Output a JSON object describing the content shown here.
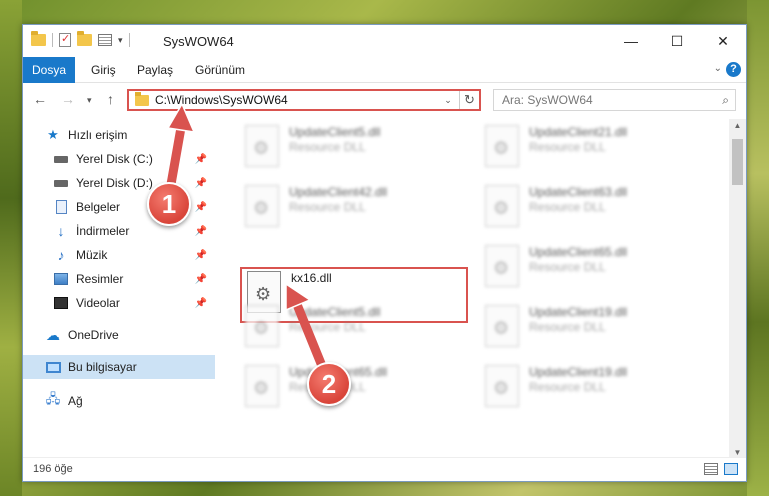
{
  "window": {
    "title": "SysWOW64",
    "minimize": "—",
    "maximize": "☐",
    "close": "✕"
  },
  "ribbon": {
    "tabs": [
      "Dosya",
      "Giriş",
      "Paylaş",
      "Görünüm"
    ],
    "help": "?"
  },
  "navbar": {
    "back": "←",
    "forward": "→",
    "recent": "▾",
    "up": "↑",
    "address": "C:\\Windows\\SysWOW64",
    "refresh": "↻",
    "search_placeholder": "Ara: SysWOW64"
  },
  "sidebar": {
    "items": [
      {
        "label": "Hızlı erişim",
        "icon": "star-icon"
      },
      {
        "label": "Yerel Disk (C:)",
        "icon": "disk-icon",
        "pinned": true
      },
      {
        "label": "Yerel Disk (D:)",
        "icon": "disk-icon",
        "pinned": true
      },
      {
        "label": "Belgeler",
        "icon": "document-icon",
        "pinned": true
      },
      {
        "label": "İndirmeler",
        "icon": "download-icon",
        "pinned": true
      },
      {
        "label": "Müzik",
        "icon": "music-icon",
        "pinned": true
      },
      {
        "label": "Resimler",
        "icon": "pictures-icon",
        "pinned": true
      },
      {
        "label": "Videolar",
        "icon": "video-icon",
        "pinned": true
      },
      {
        "label": "OneDrive",
        "icon": "cloud-icon"
      },
      {
        "label": "Bu bilgisayar",
        "icon": "computer-icon",
        "selected": true
      },
      {
        "label": "Ağ",
        "icon": "network-icon"
      }
    ]
  },
  "files": [
    {
      "name": "UpdateClient5.dll",
      "type": "Resource DLL"
    },
    {
      "name": "UpdateClient21.dll",
      "type": "Resource DLL"
    },
    {
      "name": "UpdateClient42.dll",
      "type": "Resource DLL"
    },
    {
      "name": "UpdateClient63.dll",
      "type": "Resource DLL"
    },
    {
      "name": "kx16.dll",
      "type": ""
    },
    {
      "name": "UpdateClient65.dll",
      "type": "Resource DLL"
    },
    {
      "name": "UpdateClient5.dll",
      "type": "Resource DLL"
    },
    {
      "name": "UpdateClient19.dll",
      "type": "Resource DLL"
    },
    {
      "name": "UpdateClient65.dll",
      "type": "Resource DLL"
    },
    {
      "name": "UpdateClient19.dll",
      "type": "Resource DLL"
    }
  ],
  "status": {
    "item_count": "196 öğe"
  },
  "annotations": {
    "marker1": "1",
    "marker2": "2",
    "color": "#d9534f"
  }
}
